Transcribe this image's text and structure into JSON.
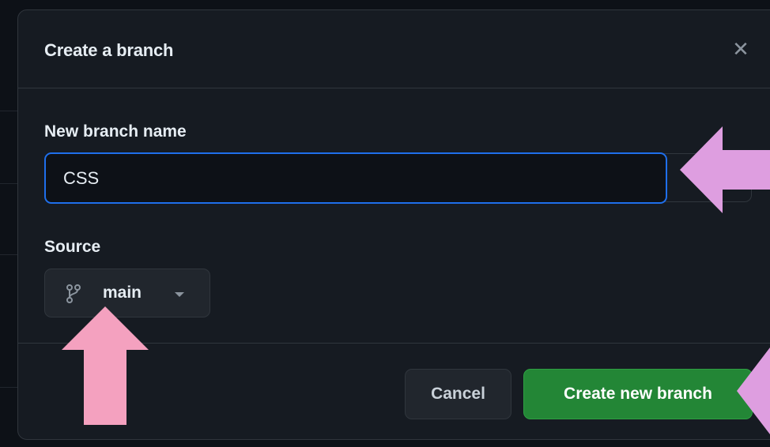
{
  "dialog": {
    "title": "Create a branch",
    "close_icon": "close-icon",
    "close_glyph": "✕"
  },
  "branch_name": {
    "label": "New branch name",
    "value": "CSS"
  },
  "source": {
    "label": "Source",
    "selected": "main",
    "icon": "git-branch-icon"
  },
  "actions": {
    "cancel_label": "Cancel",
    "create_label": "Create new branch"
  },
  "colors": {
    "background": "#0d1117",
    "dialog": "#161b22",
    "focus_border": "#1f6feb",
    "primary_button": "#238636",
    "annotation_arrow_violet": "#de9ee0",
    "annotation_arrow_pink": "#f4a1bf"
  }
}
